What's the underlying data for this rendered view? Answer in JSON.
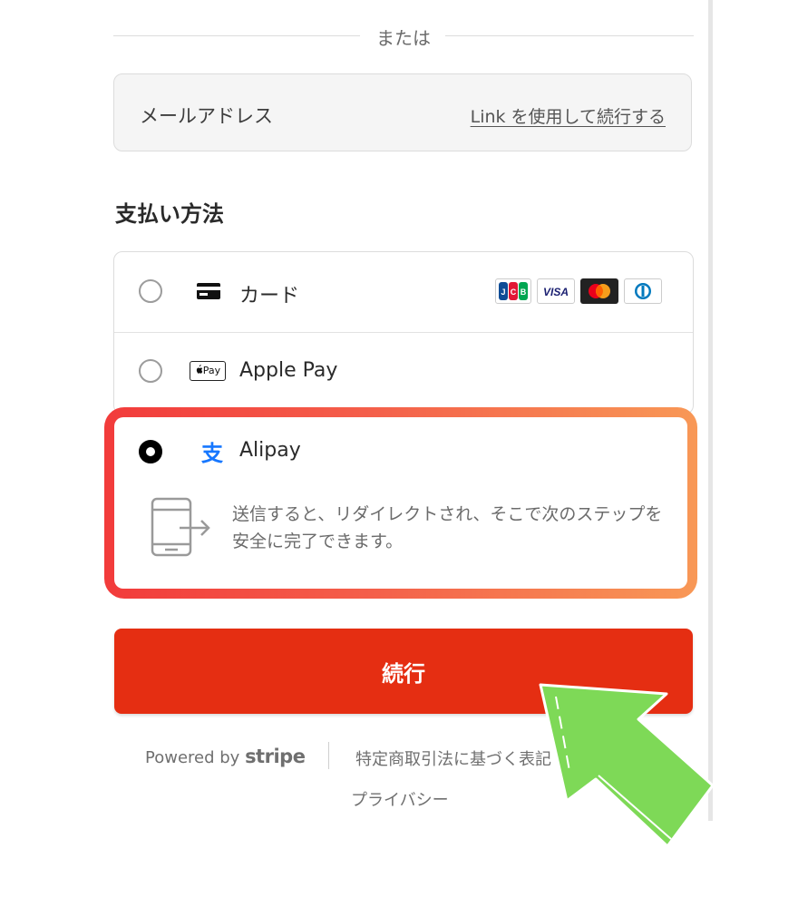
{
  "divider": {
    "text": "または"
  },
  "email": {
    "label": "メールアドレス",
    "link": "Link を使用して続行する"
  },
  "section_title": "支払い方法",
  "payment_methods": [
    {
      "label": "カード",
      "icon": "card-icon",
      "selected": false,
      "brands": [
        "JCB",
        "VISA",
        "Mastercard",
        "Diners Club"
      ]
    },
    {
      "label": "Apple Pay",
      "icon": "apple-pay-icon",
      "icon_text": "Pay",
      "selected": false
    },
    {
      "label": "Alipay",
      "icon": "alipay-icon",
      "icon_text": "支",
      "selected": true,
      "description": "送信すると、リダイレクトされ、そこで次のステップを安全に完了できます。"
    }
  ],
  "continue_button": "続行",
  "footer": {
    "powered_by": "Powered by",
    "brand": "stripe",
    "legal": "特定商取引法に基づく表記",
    "privacy": "プライバシー"
  },
  "colors": {
    "accent": "#e52e12",
    "highlight_start": "#f23b3b",
    "highlight_end": "#f89856",
    "arrow": "#7ed957"
  }
}
